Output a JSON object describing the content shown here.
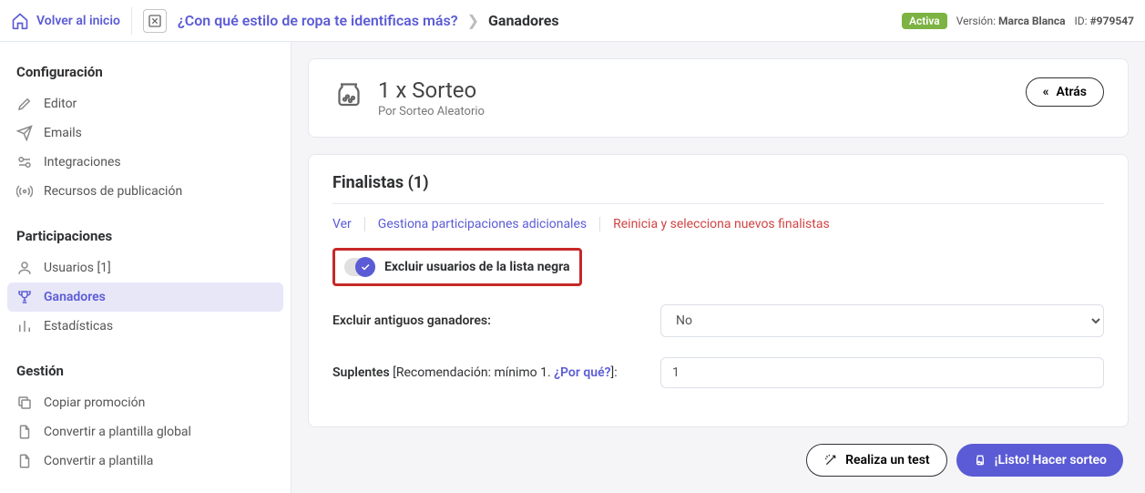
{
  "topbar": {
    "home": "Volver al inicio",
    "title": "¿Con qué estilo de ropa te identificas más?",
    "current": "Ganadores",
    "status": "Activa",
    "version_prefix": "Versión: ",
    "version_value": "Marca Blanca",
    "id_prefix": "ID: ",
    "id_value": "#979547"
  },
  "sidebar": {
    "s1_title": "Configuración",
    "s1": [
      {
        "label": "Editor"
      },
      {
        "label": "Emails"
      },
      {
        "label": "Integraciones"
      },
      {
        "label": "Recursos de publicación"
      }
    ],
    "s2_title": "Participaciones",
    "s2": [
      {
        "label": "Usuarios [1]"
      },
      {
        "label": "Ganadores"
      },
      {
        "label": "Estadísticas"
      }
    ],
    "s3_title": "Gestión",
    "s3": [
      {
        "label": "Copiar promoción"
      },
      {
        "label": "Convertir a plantilla global"
      },
      {
        "label": "Convertir a plantilla"
      }
    ]
  },
  "header_card": {
    "title": "1 x Sorteo",
    "subtitle": "Por Sorteo Aleatorio",
    "back": "Atrás"
  },
  "finalists": {
    "heading": "Finalistas (1)",
    "tabs": {
      "view": "Ver",
      "manage": "Gestiona participaciones adicionales",
      "reset": "Reinicia y selecciona nuevos finalistas"
    },
    "blacklist_toggle": "Excluir usuarios de la lista negra",
    "exclude_old_label": "Excluir antiguos ganadores:",
    "exclude_old_value": "No",
    "substitutes_label": "Suplentes",
    "substitutes_meta": " [Recomendación: mínimo 1. ",
    "substitutes_why": "¿Por qué?",
    "substitutes_meta_end": "]:",
    "substitutes_value": "1"
  },
  "footer": {
    "test": "Realiza un test",
    "go": "¡Listo! Hacer sorteo"
  }
}
